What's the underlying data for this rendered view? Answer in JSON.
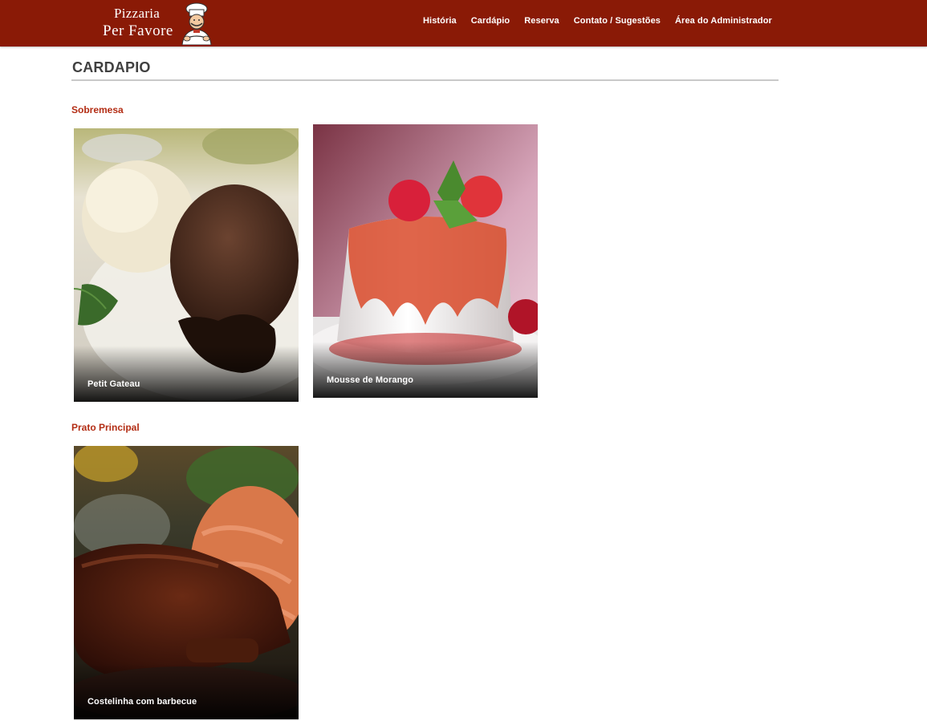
{
  "header": {
    "logo_line1": "Pizzaria",
    "logo_line2": "Per Favore",
    "nav": [
      "História",
      "Cardápio",
      "Reserva",
      "Contato / Sugestões",
      "Área do Administrador"
    ]
  },
  "page": {
    "title": "CARDAPIO"
  },
  "sections": [
    {
      "title": "Sobremesa",
      "items": [
        {
          "label": "Petit Gateau",
          "image": "chocolate-lava-cake-with-ice-cream"
        },
        {
          "label": "Mousse de Morango",
          "image": "panna-cotta-with-strawberry-sauce"
        }
      ]
    },
    {
      "title": "Prato Principal",
      "items": [
        {
          "label": "Costelinha com barbecue",
          "image": "barbecue-ribs-with-rice"
        }
      ]
    }
  ],
  "colors": {
    "header_bg": "#8a1a06",
    "section_title": "#b32d14",
    "page_title": "#404040"
  }
}
